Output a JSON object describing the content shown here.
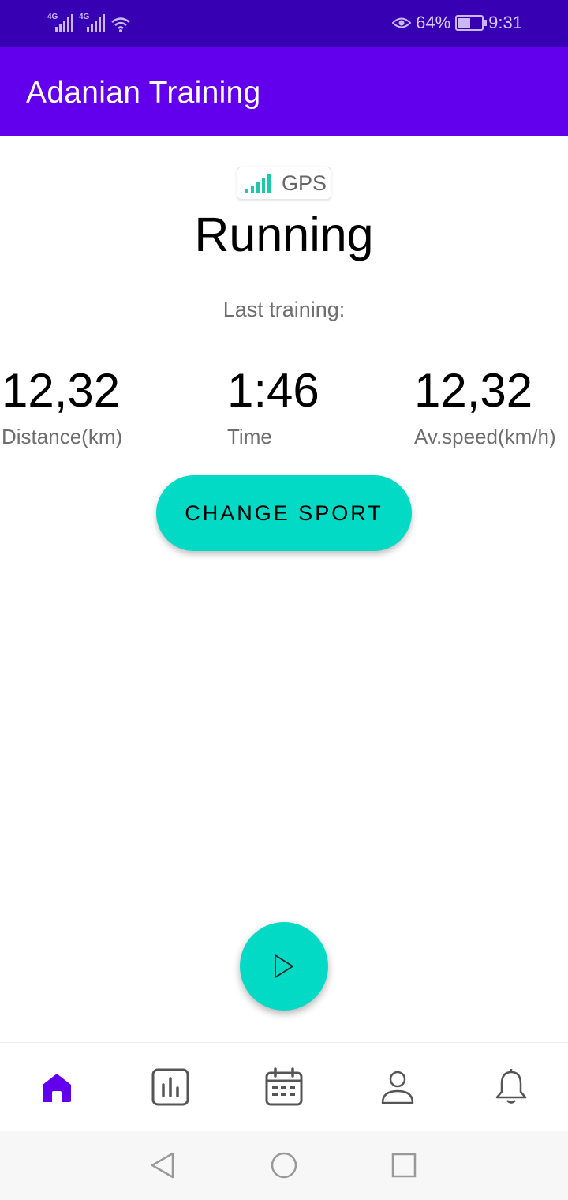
{
  "status_bar": {
    "signal_1_tag": "4G",
    "signal_2_tag": "4G",
    "battery_percent": "64%",
    "battery_level": 0.64,
    "time": "9:31",
    "icons": [
      "signal-icon",
      "signal-icon",
      "wifi-icon",
      "eye-icon",
      "battery-icon"
    ]
  },
  "app_bar": {
    "title": "Adanian Training"
  },
  "gps": {
    "label": "GPS",
    "icon": "gps-signal-icon",
    "color": "#1fc8a8"
  },
  "sport": {
    "name": "Running"
  },
  "last_training": {
    "heading": "Last training:",
    "stats": [
      {
        "value": "12,32",
        "label": "Distance(km)"
      },
      {
        "value": "1:46",
        "label": "Time"
      },
      {
        "value": "12,32",
        "label": "Av.speed(km/h)"
      }
    ]
  },
  "actions": {
    "change_sport_label": "CHANGE SPORT",
    "start_icon": "play-icon"
  },
  "bottom_nav": {
    "items": [
      {
        "icon": "home-icon",
        "active": true
      },
      {
        "icon": "stats-icon",
        "active": false
      },
      {
        "icon": "calendar-icon",
        "active": false
      },
      {
        "icon": "profile-icon",
        "active": false
      },
      {
        "icon": "bell-icon",
        "active": false
      }
    ],
    "active_color": "#6200ee",
    "inactive_color": "#555555"
  },
  "system_nav": {
    "icons": [
      "back-icon",
      "home-circle-icon",
      "recents-icon"
    ]
  },
  "colors": {
    "status_bar": "#3700b3",
    "app_bar": "#6200ee",
    "accent": "#03dac5"
  }
}
